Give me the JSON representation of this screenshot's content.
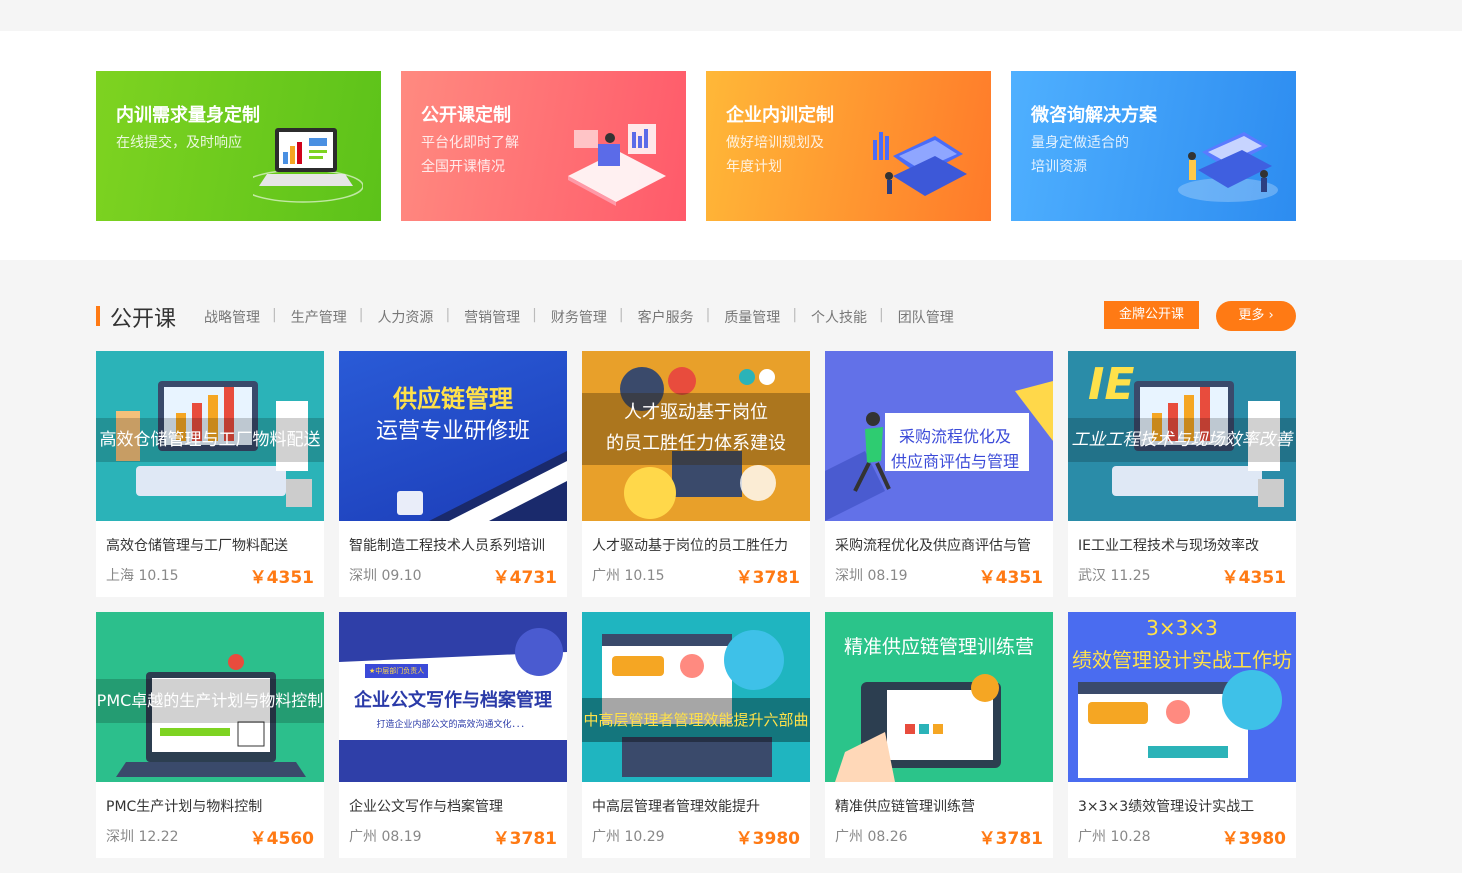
{
  "banners": [
    {
      "title": "内训需求量身定制",
      "subtitle": "在线提交，及时响应"
    },
    {
      "title": "公开课定制",
      "subtitle": "平台化即时了解\n全国开课情况"
    },
    {
      "title": "企业内训定制",
      "subtitle": "做好培训规划及\n年度计划"
    },
    {
      "title": "微咨询解决方案",
      "subtitle": "量身定做适合的\n培训资源"
    }
  ],
  "section": {
    "title": "公开课",
    "categories": [
      "战略管理",
      "生产管理",
      "人力资源",
      "营销管理",
      "财务管理",
      "客户服务",
      "质量管理",
      "个人技能",
      "团队管理"
    ],
    "gold_button": "金牌公开课",
    "more_button": "更多"
  },
  "courses": [
    {
      "thumb_text": "高效仓储管理与工厂物料配送",
      "title": "高效仓储管理与工厂物料配送",
      "city": "上海",
      "date": "10.15",
      "price": "￥4351"
    },
    {
      "thumb_text": "供应链管理",
      "thumb_text2": "运营专业研修班",
      "title": "智能制造工程技术人员系列培训",
      "city": "深圳",
      "date": "09.10",
      "price": "￥4731"
    },
    {
      "thumb_text": "人才驱动基于岗位",
      "thumb_text2": "的员工胜任力体系建设",
      "title": "人才驱动基于岗位的员工胜任力",
      "city": "广州",
      "date": "10.15",
      "price": "￥3781"
    },
    {
      "thumb_text": "采购流程优化及",
      "thumb_text2": "供应商评估与管理",
      "title": "采购流程优化及供应商评估与管",
      "city": "深圳",
      "date": "08.19",
      "price": "￥4351"
    },
    {
      "thumb_text": "工业工程技术与现场效率改善",
      "thumb_badge": "IE",
      "title": "IE工业工程技术与现场效率改",
      "city": "武汉",
      "date": "11.25",
      "price": "￥4351"
    },
    {
      "thumb_text": "PMC卓越的生产计划与物料控制",
      "title": "PMC生产计划与物料控制",
      "city": "深圳",
      "date": "12.22",
      "price": "￥4560"
    },
    {
      "thumb_text": "企业公文写作与档案管理",
      "thumb_text2": "打造企业内部公文的高效沟通文化．．．",
      "thumb_tag": "★中层部门负责人",
      "title": "企业公文写作与档案管理",
      "city": "广州",
      "date": "08.19",
      "price": "￥3781"
    },
    {
      "thumb_text": "中高层管理者管理效能提升六部曲",
      "title": "中高层管理者管理效能提升",
      "city": "广州",
      "date": "10.29",
      "price": "￥3980"
    },
    {
      "thumb_text": "精准供应链管理训练营",
      "title": "精准供应链管理训练营",
      "city": "广州",
      "date": "08.26",
      "price": "￥3781"
    },
    {
      "thumb_text": "3×3×3",
      "thumb_text2": "绩效管理设计实战工作坊",
      "title": "3×3×3绩效管理设计实战工",
      "city": "广州",
      "date": "10.28",
      "price": "￥3980"
    }
  ]
}
